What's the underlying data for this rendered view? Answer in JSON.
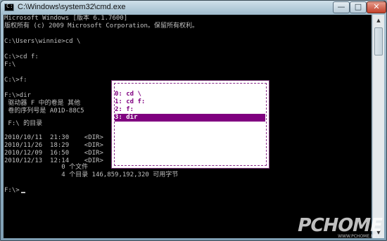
{
  "window": {
    "title": "C:\\Windows\\system32\\cmd.exe",
    "icon_label": "C:\\",
    "minimize_label": "—",
    "maximize_label": "□",
    "close_label": "✕"
  },
  "console": {
    "lines": [
      "Microsoft Windows [版本 6.1.7600]",
      "版权所有 (c) 2009 Microsoft Corporation。保留所有权利。",
      "C:\\Users\\winnie>cd \\",
      "C:\\>cd f:",
      "F:\\",
      "C:\\>f:",
      "F:\\>dir",
      " 驱动器 F 中的卷是 其他",
      " 卷的序列号是 A01D-88C5",
      " F:\\ 的目录",
      "2010/10/11  21:30    <DIR>",
      "2010/11/26  18:29    <DIR>",
      "2010/12/09  16:50    <DIR>",
      "2010/12/13  12:14    <DIR>",
      "               0 个文件",
      "               4 个目录 146,859,192,320 可用字节",
      "F:\\>"
    ]
  },
  "history_popup": {
    "items": [
      {
        "label": "0: cd \\",
        "selected": false
      },
      {
        "label": "1: cd f:",
        "selected": false
      },
      {
        "label": "2: f:",
        "selected": false
      },
      {
        "label": "3: dir",
        "selected": true
      }
    ]
  },
  "scrollbar": {
    "up_icon": "▲",
    "down_icon": "▼"
  },
  "watermark": {
    "text": "PCHOME",
    "sub": "WWW.PCHOME.NET"
  }
}
